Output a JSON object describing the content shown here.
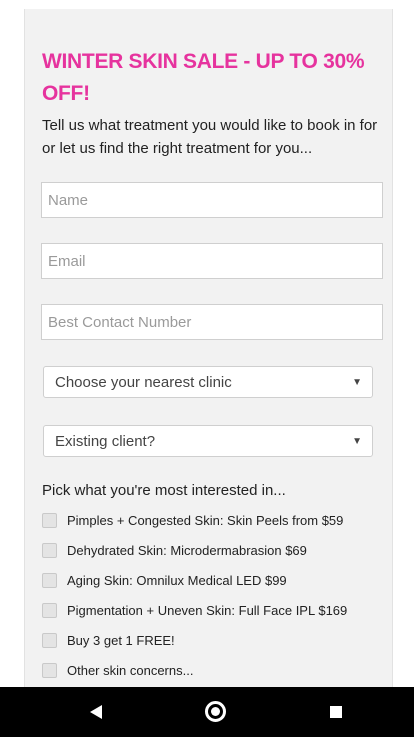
{
  "form": {
    "headline": "WINTER SKIN SALE - UP TO 30% OFF!",
    "intro": "Tell us what treatment you would like to book in for or let us find the right treatment for you...",
    "name_placeholder": "Name",
    "email_placeholder": "Email",
    "phone_placeholder": "Best Contact Number",
    "clinic_select": "Choose your nearest clinic",
    "existing_client_select": "Existing client?",
    "interest_title": "Pick what you're most interested in...",
    "options": [
      "Pimples + Congested Skin: Skin Peels from $59",
      "Dehydrated Skin: Microdermabrasion $69",
      "Aging Skin: Omnilux Medical LED $99",
      "Pigmentation + Uneven Skin: Full Face IPL $169",
      "Buy 3 get 1 FREE!",
      "Other skin concerns..."
    ]
  },
  "navbar": {
    "back_icon": "triangle-back-icon",
    "home_icon": "circle-home-icon",
    "recents_icon": "square-recents-icon"
  },
  "colors": {
    "accent": "#e6339e",
    "panel_bg": "#f2f2f2",
    "navbar_bg": "#000000"
  }
}
